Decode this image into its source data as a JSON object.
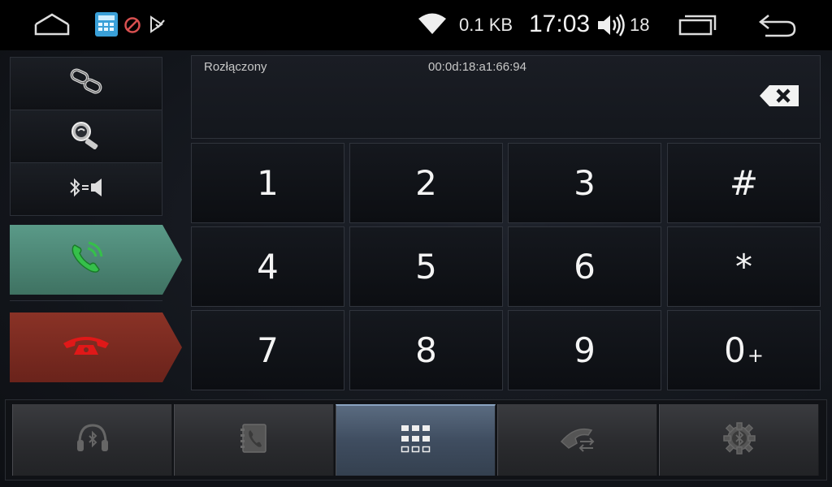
{
  "status_bar": {
    "network_speed": "0.1 KB",
    "time": "17:03",
    "volume_level": "18",
    "icons": [
      "home-icon",
      "phone-app-icon",
      "blocked-icon",
      "download-check-icon",
      "wifi-icon",
      "volume-icon",
      "recents-icon",
      "back-icon"
    ]
  },
  "phone": {
    "connection_status": "Rozłączony",
    "device_address": "00:0d:18:a1:66:94",
    "side_buttons": [
      "link-icon",
      "search-device-icon",
      "bluetooth-audio-switch-icon",
      "call-icon",
      "hangup-icon"
    ],
    "keys": [
      {
        "label": "1",
        "sub": ""
      },
      {
        "label": "2",
        "sub": ""
      },
      {
        "label": "3",
        "sub": ""
      },
      {
        "label": "#",
        "sub": ""
      },
      {
        "label": "4",
        "sub": ""
      },
      {
        "label": "5",
        "sub": ""
      },
      {
        "label": "6",
        "sub": ""
      },
      {
        "label": "*",
        "sub": ""
      },
      {
        "label": "7",
        "sub": ""
      },
      {
        "label": "8",
        "sub": ""
      },
      {
        "label": "9",
        "sub": ""
      },
      {
        "label": "0",
        "sub": "+"
      }
    ]
  },
  "tabs": {
    "items": [
      "bluetooth-music-icon",
      "contacts-icon",
      "dialpad-icon",
      "call-log-icon",
      "bluetooth-settings-icon"
    ],
    "active": "dialpad-icon"
  },
  "colors": {
    "call_button": "#4f8a78",
    "hangup_button": "#7a2b22",
    "active_tab": "#45536a"
  }
}
